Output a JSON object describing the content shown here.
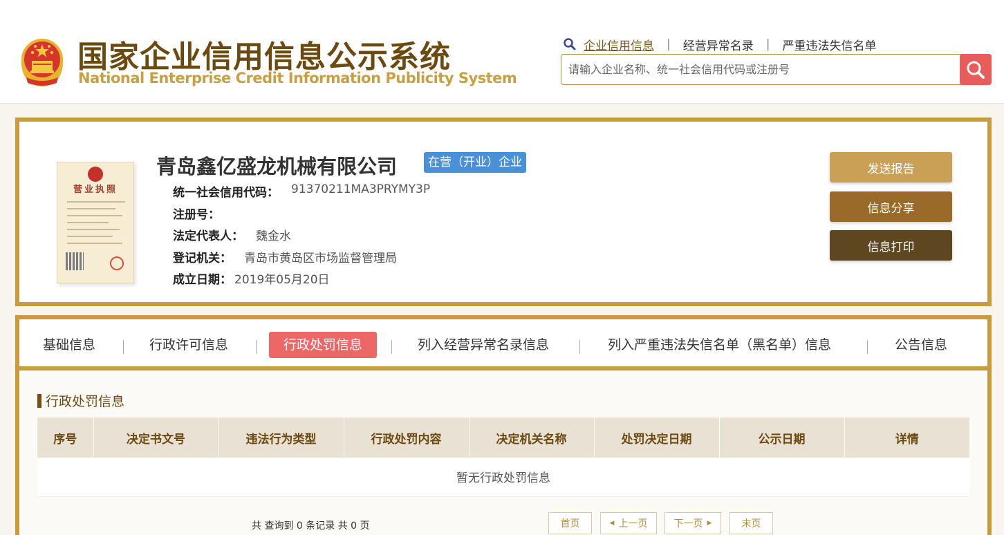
{
  "header": {
    "title_cn": "国家企业信用信息公示系统",
    "title_en": "National Enterprise Credit Information Publicity System",
    "nav": [
      {
        "label": "企业信用信息",
        "active": true
      },
      {
        "label": "经营异常名录",
        "active": false
      },
      {
        "label": "严重违法失信名单",
        "active": false
      }
    ],
    "search_placeholder": "请输入企业名称、统一社会信用代码或注册号"
  },
  "company": {
    "name": "青岛鑫亿盛龙机械有限公司",
    "status": "在营（开业）企业",
    "license_title": "营业执照",
    "fields": [
      {
        "label": "统一社会信用代码：",
        "value": "91370211MA3PRYMY3P"
      },
      {
        "label": "注册号：",
        "value": ""
      },
      {
        "label": "法定代表人：",
        "value": "魏金水"
      },
      {
        "label": "登记机关：",
        "value": "青岛市黄岛区市场监督管理局"
      },
      {
        "label": "成立日期：",
        "value": "2019年05月20日"
      }
    ],
    "actions": [
      {
        "label": "发送报告",
        "color": "#c9a056"
      },
      {
        "label": "信息分享",
        "color": "#9a6a2a"
      },
      {
        "label": "信息打印",
        "color": "#5e4621"
      }
    ]
  },
  "tabs": [
    {
      "label": "基础信息",
      "active": false
    },
    {
      "label": "行政许可信息",
      "active": false
    },
    {
      "label": "行政处罚信息",
      "active": true
    },
    {
      "label": "列入经营异常名录信息",
      "active": false
    },
    {
      "label": "列入严重违法失信名单（黑名单）信息",
      "active": false
    },
    {
      "label": "公告信息",
      "active": false
    }
  ],
  "penalty": {
    "section_title": "行政处罚信息",
    "columns": [
      "序号",
      "决定书文号",
      "违法行为类型",
      "行政处罚内容",
      "决定机关名称",
      "处罚决定日期",
      "公示日期",
      "详情"
    ],
    "empty_text": "暂无行政处罚信息",
    "record_summary": "共 查询到 0 条记录 共 0 页",
    "pager": {
      "first": "首页",
      "prev": "上一页",
      "next": "下一页",
      "last": "末页"
    }
  },
  "colors": {
    "gold_border": "#c89b3c",
    "active_tab": "#ee6767",
    "status_badge": "#4a90d9",
    "search_button": "#e85c5c"
  }
}
